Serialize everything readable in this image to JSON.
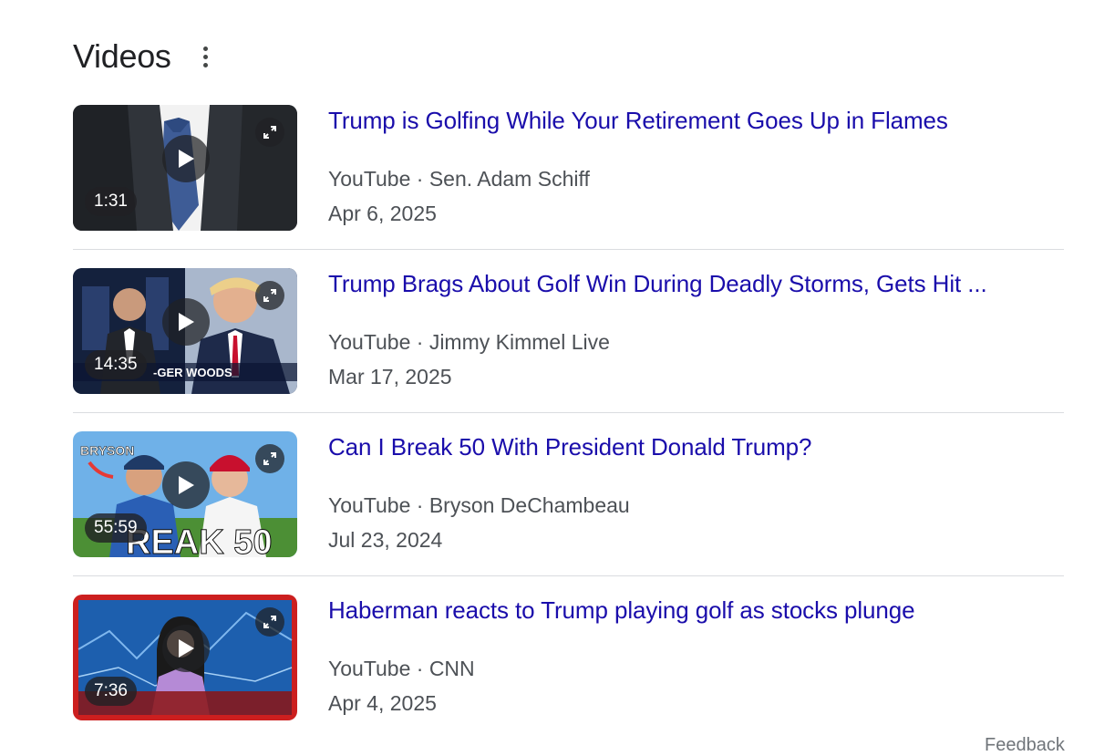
{
  "section": {
    "title": "Videos",
    "more_icon": "more-vert-icon"
  },
  "videos": [
    {
      "title": "Trump is Golfing While Your Retirement Goes Up in Flames",
      "source": "YouTube · Sen. Adam Schiff",
      "date": "Apr 6, 2025",
      "duration": "1:31"
    },
    {
      "title": "Trump Brags About Golf Win During Deadly Storms, Gets Hit ...",
      "source": "YouTube · Jimmy Kimmel Live",
      "date": "Mar 17, 2025",
      "duration": "14:35",
      "thumb_text": "-GER WOODS"
    },
    {
      "title": "Can I Break 50 With President Donald Trump?",
      "source": "YouTube · Bryson DeChambeau",
      "date": "Jul 23, 2024",
      "duration": "55:59",
      "thumb_text_left": "BRYSON",
      "thumb_text_big": "REAK 50"
    },
    {
      "title": "Haberman reacts to Trump playing golf as stocks plunge",
      "source": "YouTube · CNN",
      "date": "Apr 4, 2025",
      "duration": "7:36"
    }
  ],
  "footer": {
    "feedback": "Feedback"
  },
  "colors": {
    "link": "#1a0dab",
    "meta": "#4d5156",
    "divider": "#dadce0"
  }
}
